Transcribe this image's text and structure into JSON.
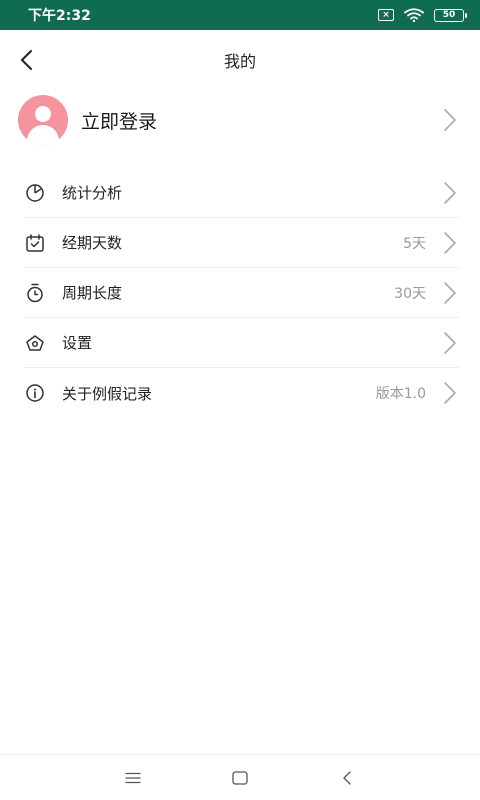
{
  "status_bar": {
    "time": "下午2:32",
    "battery": "50",
    "sim_label": "×"
  },
  "header": {
    "title": "我的"
  },
  "profile": {
    "login_label": "立即登录"
  },
  "menu": {
    "items": [
      {
        "icon": "pie-chart-icon",
        "label": "统计分析",
        "value": ""
      },
      {
        "icon": "calendar-check-icon",
        "label": "经期天数",
        "value": "5天"
      },
      {
        "icon": "timer-icon",
        "label": "周期长度",
        "value": "30天"
      },
      {
        "icon": "settings-pentagon-icon",
        "label": "设置",
        "value": ""
      },
      {
        "icon": "info-icon",
        "label": "关于例假记录",
        "value": "版本1.0"
      }
    ]
  },
  "colors": {
    "status_bar_bg": "#0f6b52",
    "avatar_bg": "#f4949e",
    "value_text": "#999999"
  }
}
